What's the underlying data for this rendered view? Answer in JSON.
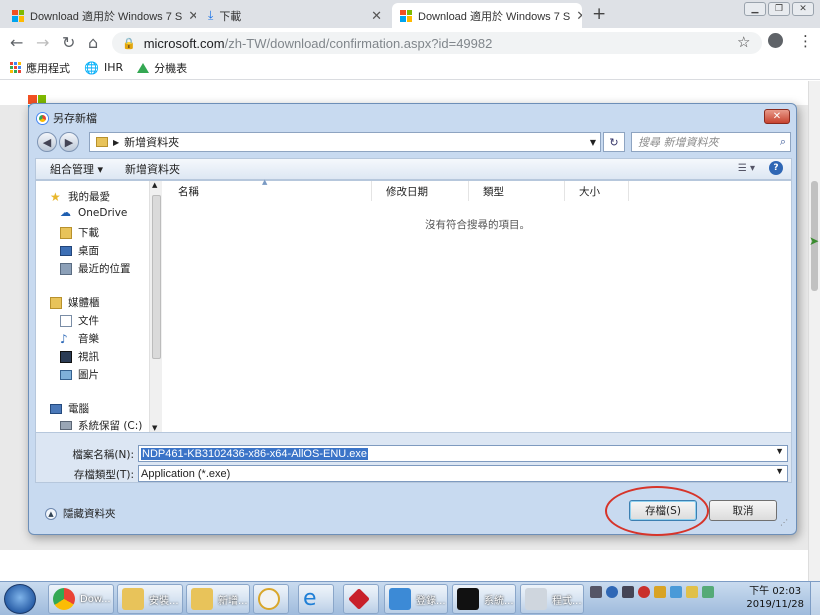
{
  "browser": {
    "tabs": [
      {
        "title": "Download 適用於 Windows 7 S",
        "icon": "microsoft-logo",
        "active": false
      },
      {
        "title": "下載",
        "icon": "download-icon",
        "active": false
      },
      {
        "title": "Download 適用於 Windows 7 S",
        "icon": "microsoft-logo",
        "active": true
      }
    ],
    "url_host": "microsoft.com",
    "url_path": "/zh-TW/download/confirmation.aspx?id=49982",
    "bookmarks": [
      {
        "label": "應用程式",
        "icon": "apps-grid-icon"
      },
      {
        "label": "IHR",
        "icon": "globe-icon"
      },
      {
        "label": "分機表",
        "icon": "google-drive-icon"
      }
    ]
  },
  "dialog": {
    "title": "另存新檔",
    "address": "新增資料夾",
    "search_placeholder": "搜尋 新增資料夾",
    "organize": "組合管理 ▾",
    "new_folder": "新增資料夾",
    "nav": {
      "favorites": "我的最愛",
      "onedrive": "OneDrive",
      "downloads": "下載",
      "desktop": "桌面",
      "recent": "最近的位置",
      "libraries": "媒體櫃",
      "documents": "文件",
      "music": "音樂",
      "videos": "視訊",
      "pictures": "圖片",
      "computer": "電腦",
      "system_drive": "系統保留 (C:)"
    },
    "columns": [
      "名稱",
      "修改日期",
      "類型",
      "大小"
    ],
    "empty_message": "沒有符合搜尋的項目。",
    "filename_label": "檔案名稱(N):",
    "filename_value": "NDP461-KB3102436-x86-x64-AllOS-ENU.exe",
    "filetype_label": "存檔類型(T):",
    "filetype_value": "Application (*.exe)",
    "hide_folders": "隱藏資料夾",
    "save_button": "存檔(S)",
    "cancel_button": "取消"
  },
  "taskbar": {
    "items": [
      "Dow...",
      "安裝...",
      "新增...",
      "",
      "",
      "",
      "登錄...",
      "系統...",
      "程式..."
    ],
    "time": "下午 02:03",
    "date": "2019/11/28"
  },
  "colors": {
    "ms_red": "#f25022",
    "ms_green": "#7fba00",
    "ms_blue": "#00a4ef",
    "ms_yellow": "#ffb900",
    "annotation_red": "#d6342a"
  }
}
